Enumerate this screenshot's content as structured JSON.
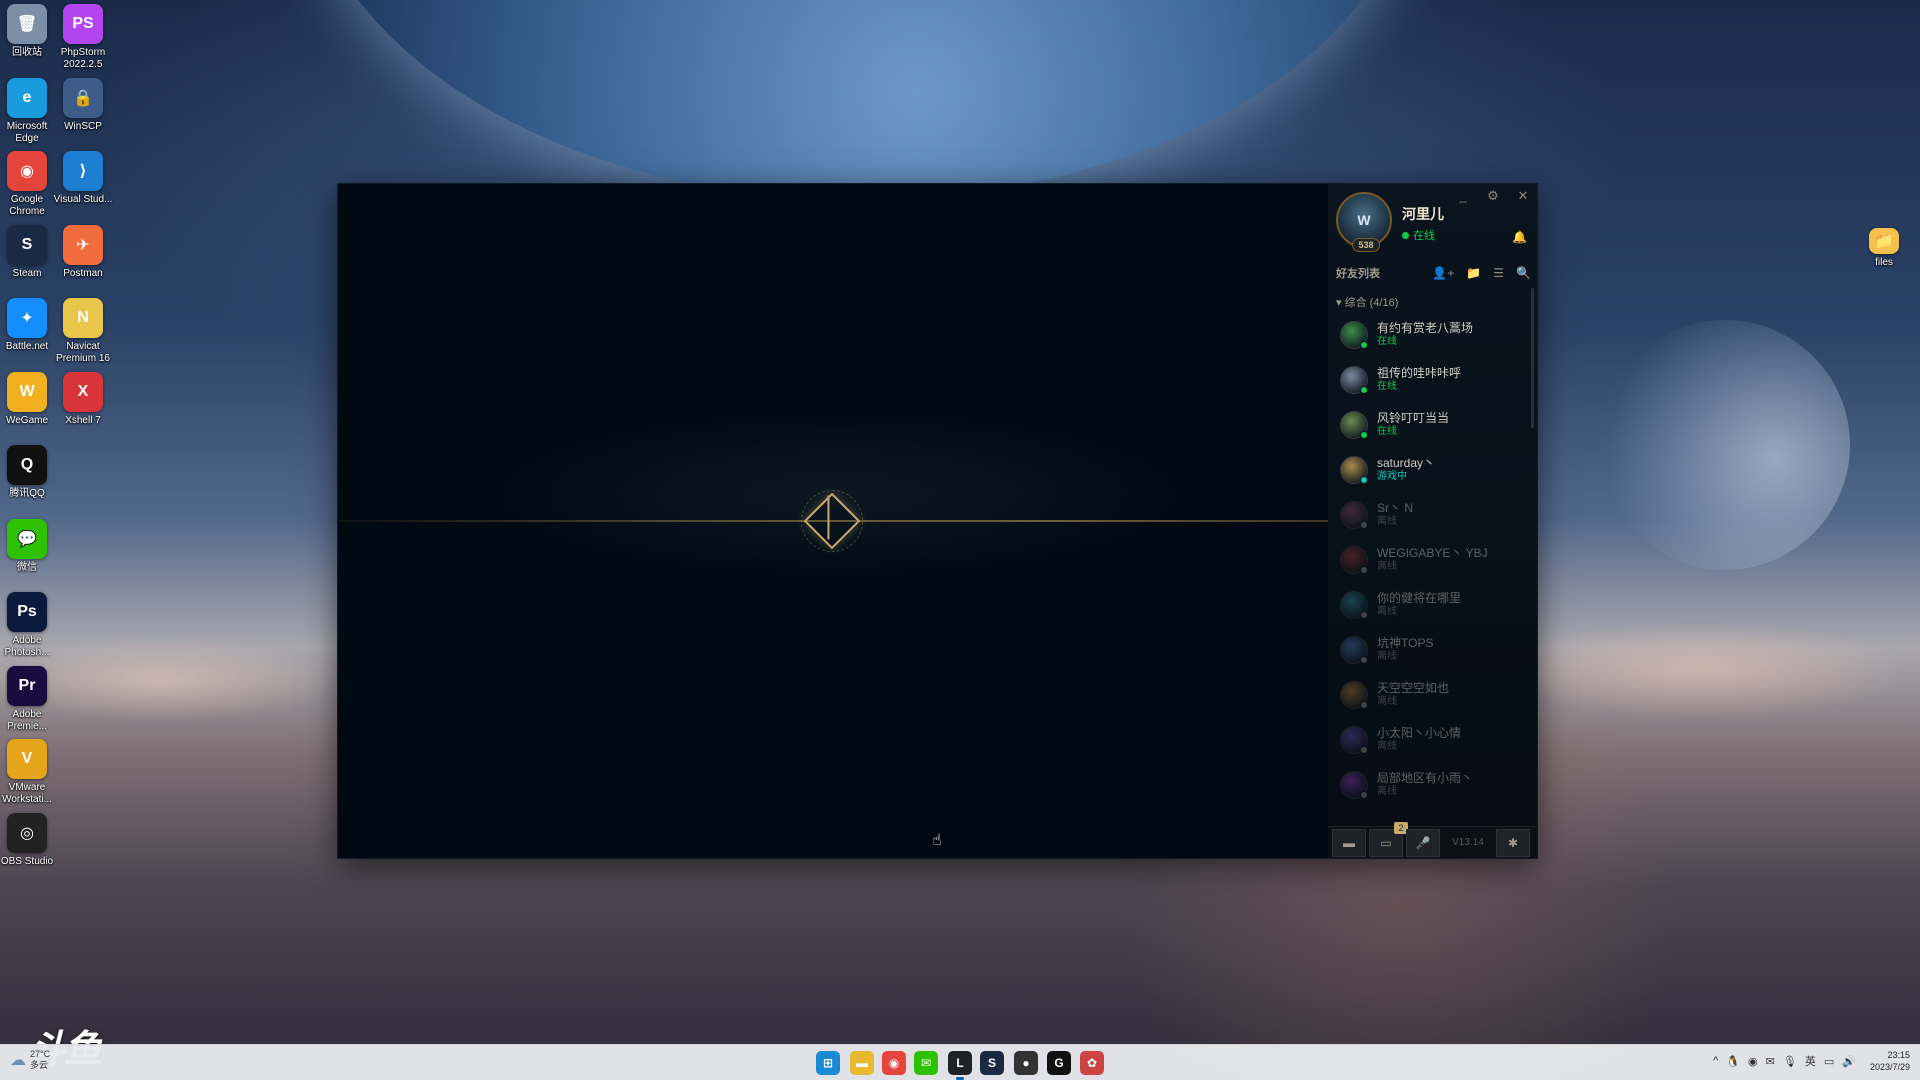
{
  "desktop": {
    "icons": [
      {
        "label": "回收站",
        "glyph": "🗑",
        "bg": "#7b8fa8"
      },
      {
        "label": "PhpStorm 2022.2.5",
        "glyph": "PS",
        "bg": "#b345f1"
      },
      {
        "label": "Microsoft Edge",
        "glyph": "e",
        "bg": "#1a9be0"
      },
      {
        "label": "WinSCP",
        "glyph": "🔒",
        "bg": "#3d5c8a"
      },
      {
        "label": "Google Chrome",
        "glyph": "◉",
        "bg": "#e5453a"
      },
      {
        "label": "Visual Stud...",
        "glyph": "⟩",
        "bg": "#1e7fd2"
      },
      {
        "label": "Steam",
        "glyph": "S",
        "bg": "#1b2a44"
      },
      {
        "label": "Postman",
        "glyph": "✈",
        "bg": "#f36c3d"
      },
      {
        "label": "Battle.net",
        "glyph": "✦",
        "bg": "#148eff"
      },
      {
        "label": "Navicat Premium 16",
        "glyph": "N",
        "bg": "#e8c64a"
      },
      {
        "label": "WeGame",
        "glyph": "W",
        "bg": "#f2b01e"
      },
      {
        "label": "Xshell 7",
        "glyph": "X",
        "bg": "#d9343a"
      },
      {
        "label": "腾讯QQ",
        "glyph": "Q",
        "bg": "#111111"
      },
      {
        "label": "微信",
        "glyph": "💬",
        "bg": "#2dc100"
      },
      {
        "label": "Adobe Photosh...",
        "glyph": "Ps",
        "bg": "#0a1a3a"
      },
      {
        "label": "Adobe Premie...",
        "glyph": "Pr",
        "bg": "#1b0b3f"
      },
      {
        "label": "VMware Workstati...",
        "glyph": "V",
        "bg": "#e7a51c"
      },
      {
        "label": "OBS Studio",
        "glyph": "◎",
        "bg": "#222222"
      }
    ],
    "right_icon": {
      "label": "files",
      "glyph": "📁",
      "bg": "#f2c14e"
    }
  },
  "client": {
    "window_controls": [
      "_",
      "⚙",
      "✕"
    ],
    "profile": {
      "name": "河里儿",
      "status": "在线",
      "level": "538",
      "avatar_text": "W"
    },
    "friends_title": "好友列表",
    "tool_icons": [
      "👤+",
      "📁",
      "☰",
      "🔍"
    ],
    "group_label": "综合 (4/16)",
    "friends": [
      {
        "name": "有约有赏老八蒿场",
        "status": "在线",
        "state": "online",
        "color": "#3d8b4a"
      },
      {
        "name": "祖传的哇咔咔呼",
        "status": "在线",
        "state": "online",
        "color": "#7a8aa0"
      },
      {
        "name": "风铃叮叮当当",
        "status": "在线",
        "state": "online",
        "color": "#6b8a52"
      },
      {
        "name": "saturday丶",
        "status": "游戏中",
        "state": "ingame",
        "color": "#a88a4a"
      },
      {
        "name": "Sr丶 N",
        "status": "离线",
        "state": "offline",
        "color": "#8a4a6b"
      },
      {
        "name": "WEGIGABYE丶 YBJ",
        "status": "离线",
        "state": "offline",
        "color": "#a03a3a"
      },
      {
        "name": "你的健将在哪里",
        "status": "离线",
        "state": "offline",
        "color": "#3a8a9a"
      },
      {
        "name": "坑神TOPS",
        "status": "离线",
        "state": "offline",
        "color": "#4a7ab0"
      },
      {
        "name": "天空空空如也",
        "status": "离线",
        "state": "offline",
        "color": "#b0803a"
      },
      {
        "name": "小太阳丶小心情",
        "status": "离线",
        "state": "offline",
        "color": "#6a4ab0"
      },
      {
        "name": "局部地区有小雨丶",
        "status": "离线",
        "state": "offline",
        "color": "#8a3ab0"
      }
    ],
    "status_colors": {
      "online": "#0acb4d",
      "ingame": "#0ac8b9",
      "offline": "#8c8c8c"
    },
    "footer": {
      "chat_icon": "chat-icon",
      "notifications_badge": "2",
      "version": "V13.14"
    }
  },
  "taskbar": {
    "weather_temp": "27°C",
    "weather_desc": "多云",
    "watermark": "斗鱼",
    "tray_lang": "英",
    "time": "23:15",
    "date": "2023/7/29"
  }
}
